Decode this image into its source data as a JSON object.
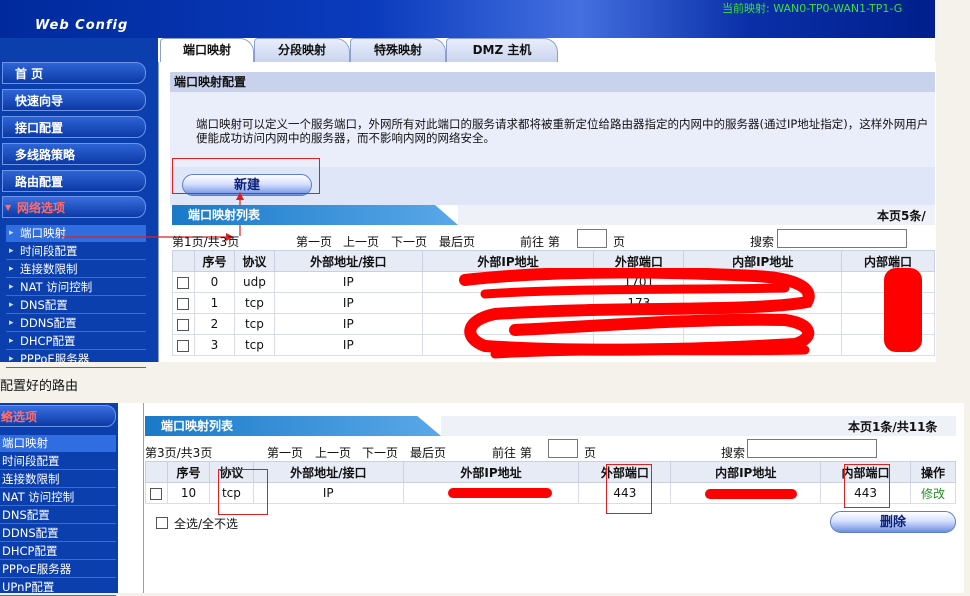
{
  "top": {
    "brand": "Web Config",
    "banner": "当前映射: WAN0-TP0-WAN1-TP1-G",
    "nav": [
      {
        "label": "首 页"
      },
      {
        "label": "快速向导"
      },
      {
        "label": "接口配置"
      },
      {
        "label": "多线路策略"
      },
      {
        "label": "路由配置"
      },
      {
        "label": "网络选项"
      }
    ],
    "subnav": [
      {
        "label": "端口映射"
      },
      {
        "label": "时间段配置"
      },
      {
        "label": "连接数限制"
      },
      {
        "label": "NAT 访问控制"
      },
      {
        "label": "DNS配置"
      },
      {
        "label": "DDNS配置"
      },
      {
        "label": "DHCP配置"
      },
      {
        "label": "PPPoE服务器"
      }
    ],
    "tabs": [
      {
        "label": "端口映射"
      },
      {
        "label": "分段映射"
      },
      {
        "label": "特殊映射"
      },
      {
        "label": "DMZ 主机"
      }
    ],
    "config_title": "端口映射配置",
    "description": "端口映射可以定义一个服务端口，外网所有对此端口的服务请求都将被重新定位给路由器指定的内网中的服务器(通过IP地址指定)，这样外网用户便能成功访问内网中的服务器，而不影响内网的网络安全。",
    "new_button": "新建",
    "list_title": "端口映射列表",
    "page_count": "本页5条/",
    "pager": {
      "page_info": "第1页/共3页",
      "first": "第一页",
      "prev": "上一页",
      "next": "下一页",
      "last": "最后页",
      "goto": "前往 第",
      "page_unit": "页",
      "search": "搜索"
    },
    "columns": [
      "序号",
      "协议",
      "外部地址/接口",
      "外部IP地址",
      "外部端口",
      "内部IP地址",
      "内部端口"
    ],
    "rows": [
      {
        "no": "0",
        "proto": "udp",
        "iface": "IP",
        "ext_port": "1701"
      },
      {
        "no": "1",
        "proto": "tcp",
        "iface": "IP",
        "ext_port": "173"
      },
      {
        "no": "2",
        "proto": "tcp",
        "iface": "IP",
        "ext_port": ""
      },
      {
        "no": "3",
        "proto": "tcp",
        "iface": "IP",
        "ext_port": ""
      }
    ]
  },
  "caption": "配置好的路由",
  "bottom": {
    "nav_open": "络选项",
    "subnav": [
      {
        "label": "端口映射"
      },
      {
        "label": "时间段配置"
      },
      {
        "label": "连接数限制"
      },
      {
        "label": "NAT 访问控制"
      },
      {
        "label": "DNS配置"
      },
      {
        "label": "DDNS配置"
      },
      {
        "label": "DHCP配置"
      },
      {
        "label": "PPPoE服务器"
      },
      {
        "label": "UPnP配置"
      }
    ],
    "list_title": "端口映射列表",
    "page_count": "本页1条/共11条",
    "pager": {
      "page_info": "第3页/共3页",
      "first": "第一页",
      "prev": "上一页",
      "next": "下一页",
      "last": "最后页",
      "goto": "前往 第",
      "page_unit": "页",
      "search": "搜索"
    },
    "columns": [
      "序号",
      "协议",
      "外部地址/接口",
      "外部IP地址",
      "外部端口",
      "内部IP地址",
      "内部端口",
      "操作"
    ],
    "row": {
      "no": "10",
      "proto": "tcp",
      "iface": "IP",
      "ext_port": "443",
      "int_port": "443",
      "action": "修改"
    },
    "select_all": "全选/全不选",
    "delete_button": "删除"
  }
}
